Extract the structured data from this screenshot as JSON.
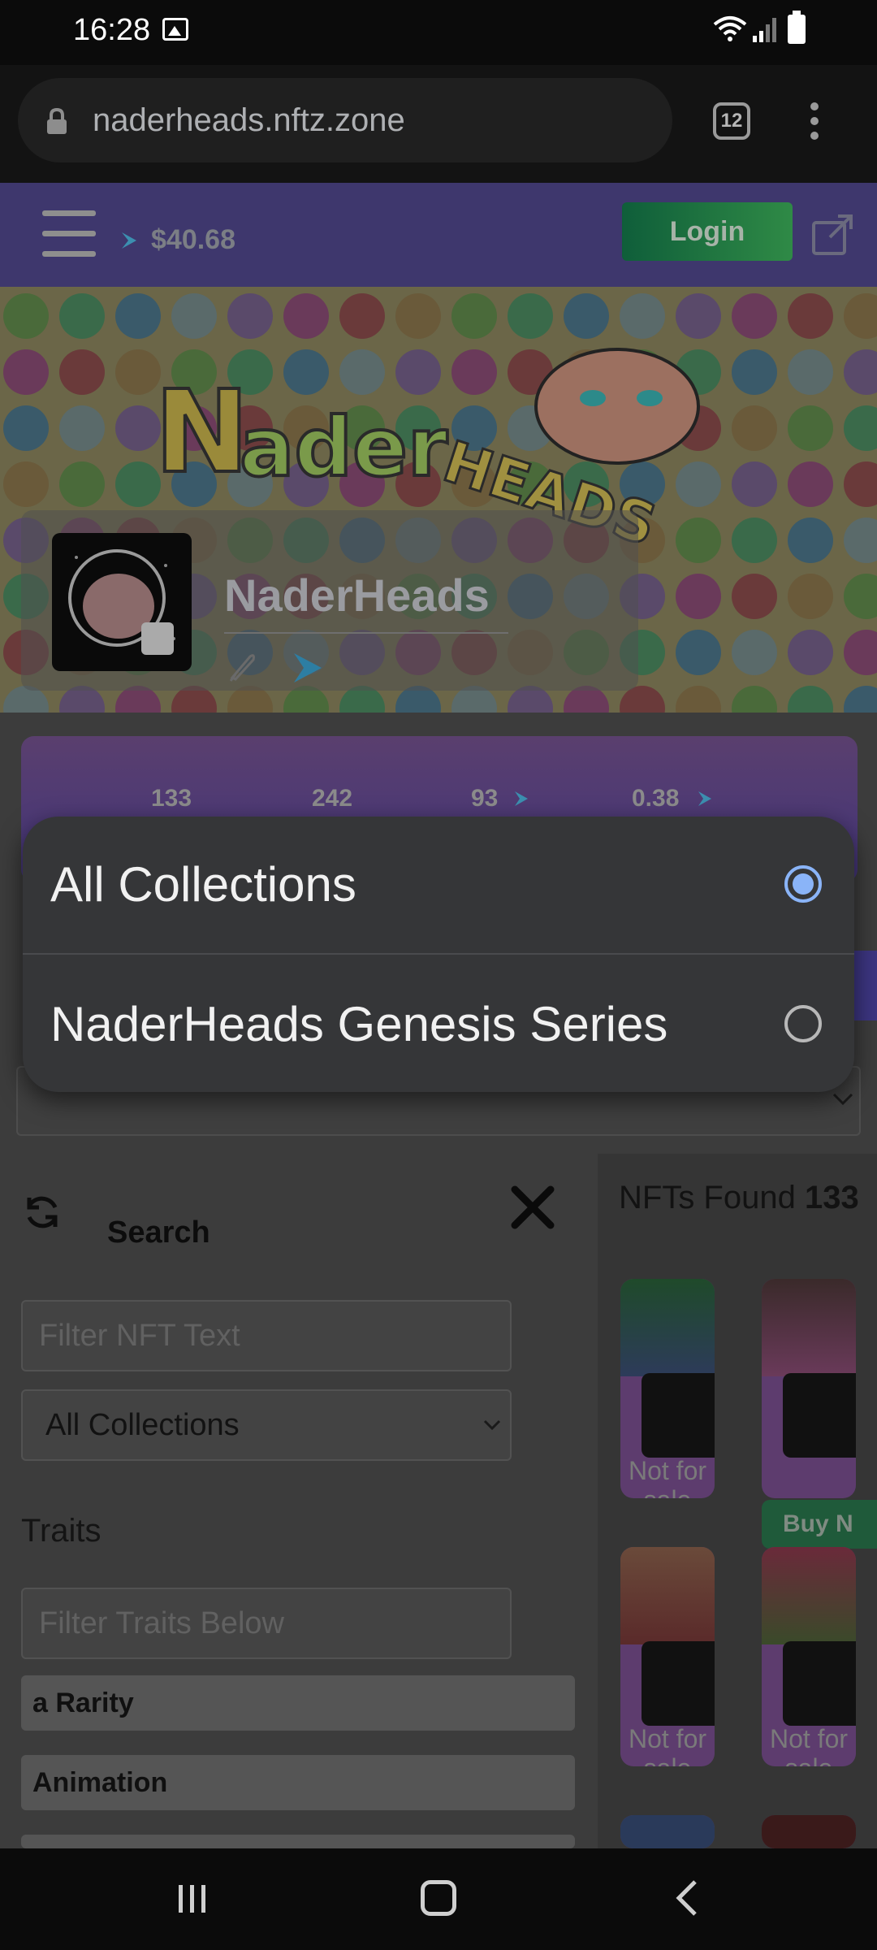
{
  "status_bar": {
    "time": "16:28"
  },
  "browser": {
    "url": "naderheads.nftz.zone",
    "tab_count": "12"
  },
  "site_header": {
    "price": "$40.68",
    "login_label": "Login"
  },
  "profile": {
    "name": "NaderHeads"
  },
  "stats": {
    "values": [
      "133",
      "242",
      "93",
      "0.38"
    ]
  },
  "search_panel": {
    "title": "Search",
    "filter_placeholder": "Filter NFT Text",
    "collection_select": "All Collections",
    "traits_label": "Traits",
    "traits_placeholder": "Filter Traits Below",
    "trait_groups": [
      "a Rarity",
      "Animation"
    ]
  },
  "results": {
    "found_label": "NFTs Found",
    "found_count": "133",
    "status_text": "Not for sale",
    "buy_label": "Buy N"
  },
  "dropdown": {
    "options": [
      {
        "label": "All Collections",
        "selected": true
      },
      {
        "label": "NaderHeads Genesis Series",
        "selected": false
      }
    ]
  },
  "colors": {
    "accent": "#8ab4f8",
    "header": "#3e376d",
    "overlay_panel": "#353638"
  }
}
